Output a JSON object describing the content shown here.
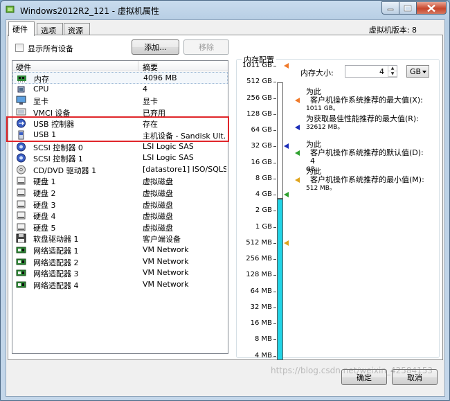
{
  "window": {
    "title": "Windows2012R2_121 - 虚拟机属性",
    "colors": {
      "selection_highlight": "#e0262a",
      "memory_bar": "#22d4e6"
    }
  },
  "tabs": [
    {
      "label": "硬件",
      "active": true
    },
    {
      "label": "选项",
      "active": false
    },
    {
      "label": "资源",
      "active": false
    }
  ],
  "version_label": "虚拟机版本: 8",
  "toolbar": {
    "show_all_devices_label": "显示所有设备",
    "show_all_devices_checked": false,
    "add_label": "添加...",
    "remove_label": "移除"
  },
  "hardware_table": {
    "columns": [
      "硬件",
      "摘要"
    ],
    "rows": [
      {
        "icon": "memory-icon",
        "name": "内存",
        "summary": "4096 MB",
        "selected": true
      },
      {
        "icon": "cpu-icon",
        "name": "CPU",
        "summary": "4"
      },
      {
        "icon": "display-icon",
        "name": "显卡",
        "summary": "显卡"
      },
      {
        "icon": "vmci-icon",
        "name": "VMCI 设备",
        "summary": "已弃用"
      },
      {
        "icon": "usb-controller-icon",
        "name": "USB 控制器",
        "summary": "存在"
      },
      {
        "icon": "usb-device-icon",
        "name": "USB 1",
        "summary": "主机设备 - Sandisk Ult..."
      },
      {
        "icon": "scsi-controller-icon",
        "name": "SCSI 控制器 0",
        "summary": "LSI Logic SAS"
      },
      {
        "icon": "scsi-controller-icon",
        "name": "SCSI 控制器 1",
        "summary": "LSI Logic SAS"
      },
      {
        "icon": "cd-dvd-icon",
        "name": "CD/DVD 驱动器 1",
        "summary": "[datastore1] ISO/SQLS..."
      },
      {
        "icon": "hard-disk-icon",
        "name": "硬盘 1",
        "summary": "虚拟磁盘"
      },
      {
        "icon": "hard-disk-icon",
        "name": "硬盘 2",
        "summary": "虚拟磁盘"
      },
      {
        "icon": "hard-disk-icon",
        "name": "硬盘 3",
        "summary": "虚拟磁盘"
      },
      {
        "icon": "hard-disk-icon",
        "name": "硬盘 4",
        "summary": "虚拟磁盘"
      },
      {
        "icon": "hard-disk-icon",
        "name": "硬盘 5",
        "summary": "虚拟磁盘"
      },
      {
        "icon": "floppy-icon",
        "name": "软盘驱动器 1",
        "summary": "客户端设备"
      },
      {
        "icon": "network-adapter-icon",
        "name": "网络适配器 1",
        "summary": "VM Network"
      },
      {
        "icon": "network-adapter-icon",
        "name": "网络适配器 2",
        "summary": "VM Network"
      },
      {
        "icon": "network-adapter-icon",
        "name": "网络适配器 3",
        "summary": "VM Network"
      },
      {
        "icon": "network-adapter-icon",
        "name": "网络适配器 4",
        "summary": "VM Network"
      }
    ]
  },
  "memory": {
    "group_title": "内存配置",
    "scale_labels": [
      "1011 GB",
      "512 GB",
      "256 GB",
      "128 GB",
      "64 GB",
      "32 GB",
      "16 GB",
      "8 GB",
      "4 GB",
      "2 GB",
      "1 GB",
      "512 MB",
      "256 MB",
      "128 MB",
      "64 MB",
      "32 MB",
      "16 MB",
      "8 MB",
      "4 MB"
    ],
    "size_label": "内存大小:",
    "size_value": "4",
    "unit": "GB",
    "legend": [
      {
        "line1": "为此",
        "line2": "客户机操作系统推荐的最大值(X):",
        "value": "1011 GB。",
        "color": "#f07a2a"
      },
      {
        "line1": "为获取最佳性能推荐的最大值(R):",
        "line2": "",
        "value": "32612 MB。",
        "color": "#1c2eb8"
      },
      {
        "line1": "为此",
        "line2": "客户机操作系统推荐的默认值(D): 4",
        "value": "GB。",
        "color": "#2fa12f"
      },
      {
        "line1": "为此",
        "line2": "客户机操作系统推荐的最小值(M):",
        "value": "512 MB。",
        "color": "#e0a41c"
      }
    ]
  },
  "footer": {
    "ok_label": "确定",
    "cancel_label": "取消"
  },
  "watermark": "https://blog.csdn.net/weixin_42584153"
}
